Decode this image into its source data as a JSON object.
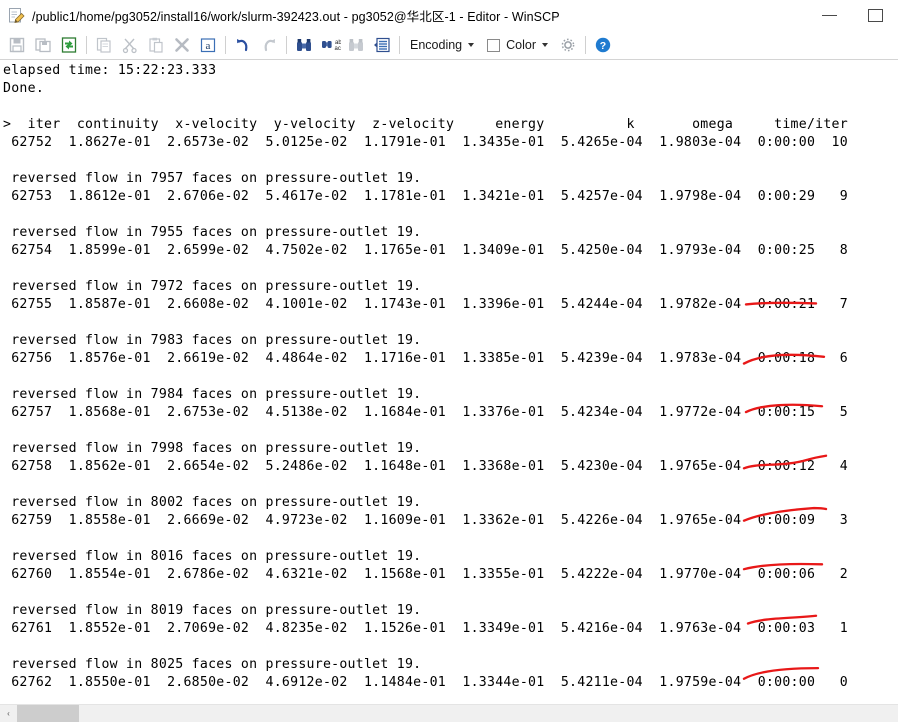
{
  "window": {
    "title": "/public1/home/pg3052/install16/work/slurm-392423.out - pg3052@华北区-1 - Editor - WinSCP",
    "icon": "editor-document-icon",
    "buttons": {
      "minimize": "—",
      "maximize": "☐"
    }
  },
  "toolbar": {
    "items": [
      {
        "name": "save-button",
        "icon": "save-icon",
        "enabled": false
      },
      {
        "name": "save-as-button",
        "icon": "save-as-icon",
        "enabled": false
      },
      {
        "name": "reload-button",
        "icon": "reload-icon",
        "enabled": true
      },
      {
        "name": "copy-button",
        "icon": "copy-icon",
        "enabled": false
      },
      {
        "name": "cut-button",
        "icon": "scissors-icon",
        "enabled": false
      },
      {
        "name": "paste-button",
        "icon": "paste-icon",
        "enabled": false
      },
      {
        "name": "delete-button",
        "icon": "x-icon",
        "enabled": false
      },
      {
        "name": "select-all-button",
        "icon": "select-all-icon",
        "enabled": true
      },
      {
        "name": "undo-button",
        "icon": "undo-arrow-icon",
        "enabled": true
      },
      {
        "name": "redo-button",
        "icon": "redo-arrow-icon",
        "enabled": false
      },
      {
        "name": "find-button",
        "icon": "binoculars-icon",
        "enabled": true
      },
      {
        "name": "replace-button",
        "icon": "replace-abac-icon",
        "enabled": true
      },
      {
        "name": "find-again-button",
        "icon": "binoculars-again-icon",
        "enabled": false
      },
      {
        "name": "go-to-line-button",
        "icon": "goto-line-icon",
        "enabled": true
      }
    ],
    "encoding_label": "Encoding",
    "color_label": "Color",
    "preferences_icon": "gear-icon",
    "help_icon": "help-question-icon"
  },
  "editor": {
    "header_line": ">  iter  continuity  x-velocity  y-velocity  z-velocity     energy          k       omega     time/iter",
    "done_line": "Done.",
    "clipped_line": "elapsed time: 15:22:23.333",
    "prompt_line": ">",
    "columns": [
      "iter",
      "continuity",
      "x-velocity",
      "y-velocity",
      "z-velocity",
      "energy",
      "k",
      "omega",
      "time/iter"
    ],
    "first_row": {
      "iter": "62752",
      "continuity": "1.8627e-01",
      "x_velocity": "2.6573e-02",
      "y_velocity": "5.0125e-02",
      "z_velocity": "1.1791e-01",
      "energy": "1.3435e-01",
      "k": "5.4265e-04",
      "omega": "1.9803e-04",
      "time": "0:00:00",
      "iter_left": "10"
    },
    "blocks": [
      {
        "warning": "reversed flow in 7957 faces on pressure-outlet 19.",
        "iter": "62753",
        "continuity": "1.8612e-01",
        "x_velocity": "2.6706e-02",
        "y_velocity": "5.4617e-02",
        "z_velocity": "1.1781e-01",
        "energy": "1.3421e-01",
        "k": "5.4257e-04",
        "omega": "1.9798e-04",
        "time": "0:00:29",
        "iter_left": "9",
        "annotated": false
      },
      {
        "warning": "reversed flow in 7955 faces on pressure-outlet 19.",
        "iter": "62754",
        "continuity": "1.8599e-01",
        "x_velocity": "2.6599e-02",
        "y_velocity": "4.7502e-02",
        "z_velocity": "1.1765e-01",
        "energy": "1.3409e-01",
        "k": "5.4250e-04",
        "omega": "1.9793e-04",
        "time": "0:00:25",
        "iter_left": "8",
        "annotated": false
      },
      {
        "warning": "reversed flow in 7972 faces on pressure-outlet 19.",
        "iter": "62755",
        "continuity": "1.8587e-01",
        "x_velocity": "2.6608e-02",
        "y_velocity": "4.1001e-02",
        "z_velocity": "1.1743e-01",
        "energy": "1.3396e-01",
        "k": "5.4244e-04",
        "omega": "1.9782e-04",
        "time": "0:00:21",
        "iter_left": "7",
        "annotated": true
      },
      {
        "warning": "reversed flow in 7983 faces on pressure-outlet 19.",
        "iter": "62756",
        "continuity": "1.8576e-01",
        "x_velocity": "2.6619e-02",
        "y_velocity": "4.4864e-02",
        "z_velocity": "1.1716e-01",
        "energy": "1.3385e-01",
        "k": "5.4239e-04",
        "omega": "1.9783e-04",
        "time": "0:00:18",
        "iter_left": "6",
        "annotated": true
      },
      {
        "warning": "reversed flow in 7984 faces on pressure-outlet 19.",
        "iter": "62757",
        "continuity": "1.8568e-01",
        "x_velocity": "2.6753e-02",
        "y_velocity": "4.5138e-02",
        "z_velocity": "1.1684e-01",
        "energy": "1.3376e-01",
        "k": "5.4234e-04",
        "omega": "1.9772e-04",
        "time": "0:00:15",
        "iter_left": "5",
        "annotated": true
      },
      {
        "warning": "reversed flow in 7998 faces on pressure-outlet 19.",
        "iter": "62758",
        "continuity": "1.8562e-01",
        "x_velocity": "2.6654e-02",
        "y_velocity": "5.2486e-02",
        "z_velocity": "1.1648e-01",
        "energy": "1.3368e-01",
        "k": "5.4230e-04",
        "omega": "1.9765e-04",
        "time": "0:00:12",
        "iter_left": "4",
        "annotated": true
      },
      {
        "warning": "reversed flow in 8002 faces on pressure-outlet 19.",
        "iter": "62759",
        "continuity": "1.8558e-01",
        "x_velocity": "2.6669e-02",
        "y_velocity": "4.9723e-02",
        "z_velocity": "1.1609e-01",
        "energy": "1.3362e-01",
        "k": "5.4226e-04",
        "omega": "1.9765e-04",
        "time": "0:00:09",
        "iter_left": "3",
        "annotated": true
      },
      {
        "warning": "reversed flow in 8016 faces on pressure-outlet 19.",
        "iter": "62760",
        "continuity": "1.8554e-01",
        "x_velocity": "2.6786e-02",
        "y_velocity": "4.6321e-02",
        "z_velocity": "1.1568e-01",
        "energy": "1.3355e-01",
        "k": "5.4222e-04",
        "omega": "1.9770e-04",
        "time": "0:00:06",
        "iter_left": "2",
        "annotated": true
      },
      {
        "warning": "reversed flow in 8019 faces on pressure-outlet 19.",
        "iter": "62761",
        "continuity": "1.8552e-01",
        "x_velocity": "2.7069e-02",
        "y_velocity": "4.8235e-02",
        "z_velocity": "1.1526e-01",
        "energy": "1.3349e-01",
        "k": "5.4216e-04",
        "omega": "1.9763e-04",
        "time": "0:00:03",
        "iter_left": "1",
        "annotated": true
      },
      {
        "warning": "reversed flow in 8025 faces on pressure-outlet 19.",
        "iter": "62762",
        "continuity": "1.8550e-01",
        "x_velocity": "2.6850e-02",
        "y_velocity": "4.6912e-02",
        "z_velocity": "1.1484e-01",
        "energy": "1.3344e-01",
        "k": "5.4211e-04",
        "omega": "1.9759e-04",
        "time": "0:00:00",
        "iter_left": "0",
        "annotated": true
      }
    ],
    "annotation_color": "#e81818"
  },
  "scrollbar": {
    "left_arrow": "‹",
    "right_arrow": "›"
  }
}
